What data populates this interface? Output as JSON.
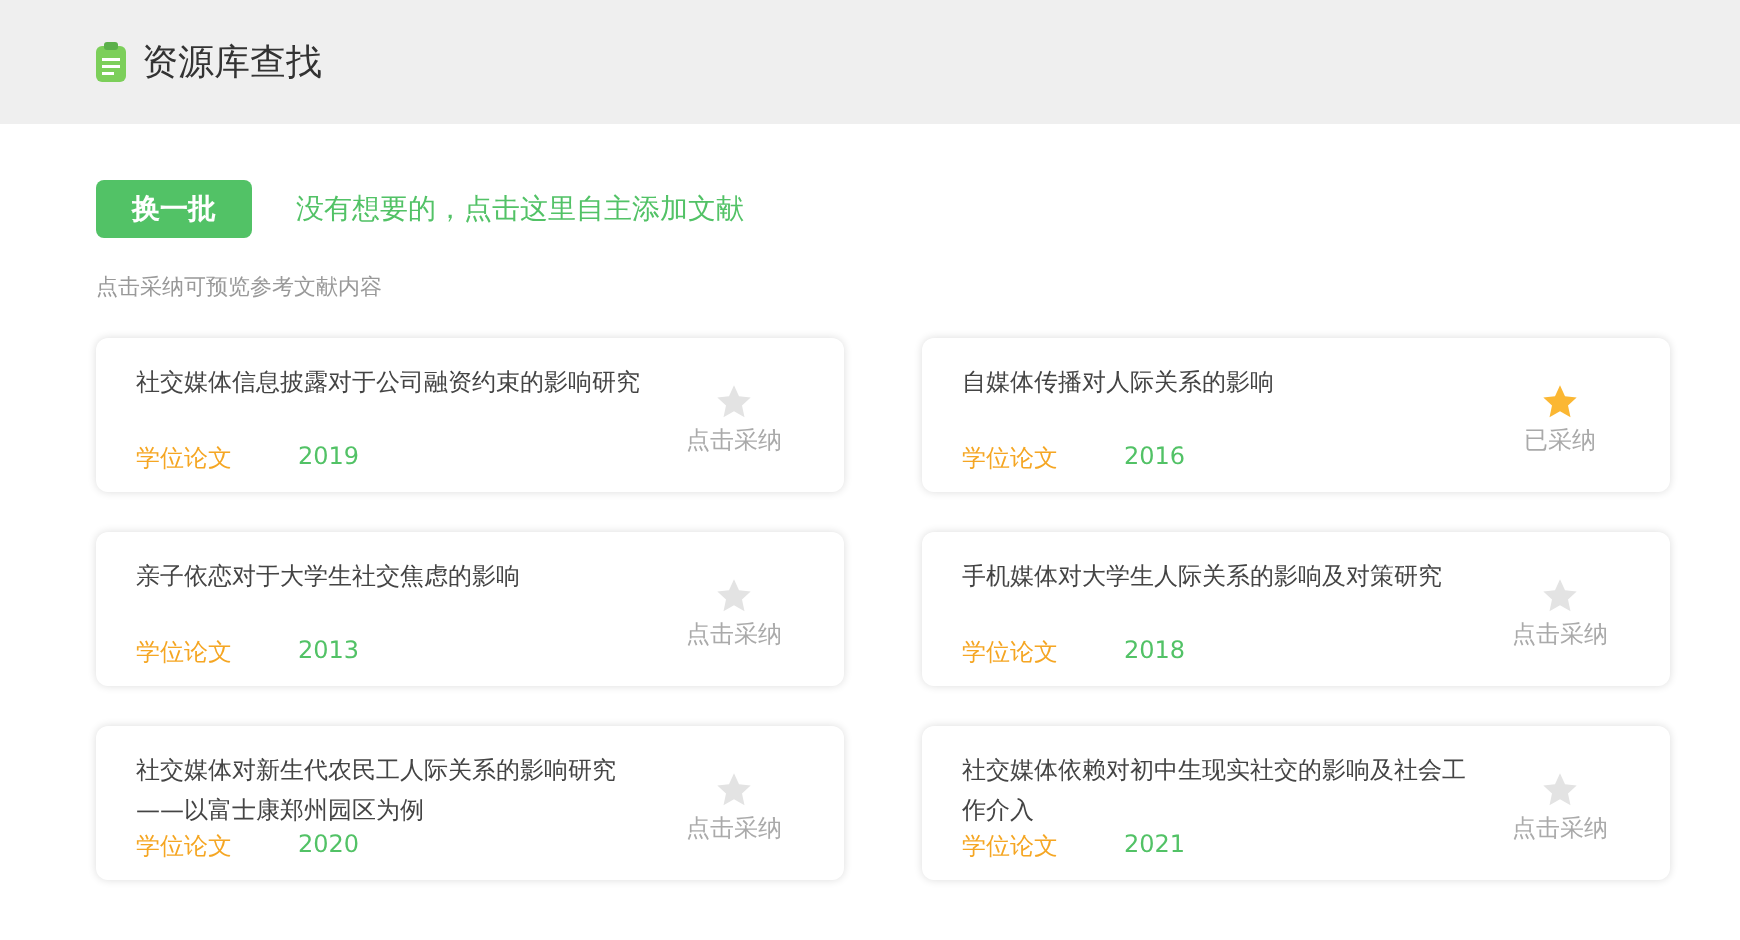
{
  "header": {
    "title": "资源库查找"
  },
  "toolbar": {
    "button": "换一批",
    "link": "没有想要的，点击这里自主添加文献"
  },
  "hint": "点击采纳可预览参考文献内容",
  "papers": [
    {
      "title": "社交媒体信息披露对于公司融资约束的影响研究",
      "type": "学位论文",
      "year": "2019",
      "adopted": false,
      "action": "点击采纳"
    },
    {
      "title": "自媒体传播对人际关系的影响",
      "type": "学位论文",
      "year": "2016",
      "adopted": true,
      "action": "已采纳"
    },
    {
      "title": "亲子依恋对于大学生社交焦虑的影响",
      "type": "学位论文",
      "year": "2013",
      "adopted": false,
      "action": "点击采纳"
    },
    {
      "title": "手机媒体对大学生人际关系的影响及对策研究",
      "type": "学位论文",
      "year": "2018",
      "adopted": false,
      "action": "点击采纳"
    },
    {
      "title": "社交媒体对新生代农民工人际关系的影响研究——以富士康郑州园区为例",
      "type": "学位论文",
      "year": "2020",
      "adopted": false,
      "action": "点击采纳"
    },
    {
      "title": "社交媒体依赖对初中生现实社交的影响及社会工作介入",
      "type": "学位论文",
      "year": "2021",
      "adopted": false,
      "action": "点击采纳"
    }
  ]
}
